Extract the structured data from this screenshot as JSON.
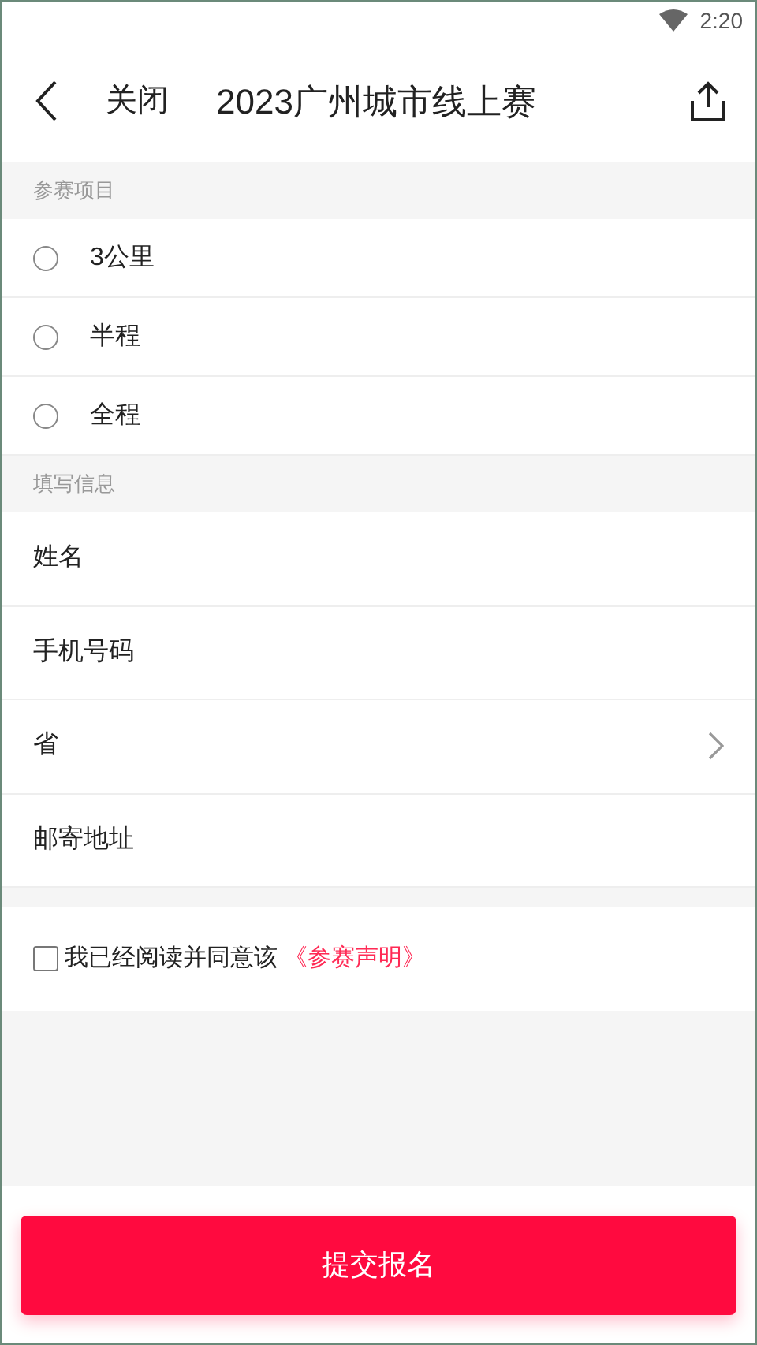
{
  "status_bar": {
    "time": "2:20"
  },
  "header": {
    "close": "关闭",
    "title": "2023广州城市线上赛"
  },
  "event_section": {
    "label": "参赛项目",
    "options": [
      {
        "label": "3公里",
        "selected": false
      },
      {
        "label": "半程",
        "selected": false
      },
      {
        "label": "全程",
        "selected": false
      }
    ]
  },
  "info_section": {
    "label": "填写信息",
    "fields": [
      {
        "label": "姓名",
        "kind": "text"
      },
      {
        "label": "手机号码",
        "kind": "text"
      },
      {
        "label": "省",
        "kind": "select"
      },
      {
        "label": "邮寄地址",
        "kind": "text"
      }
    ]
  },
  "agreement": {
    "checked": false,
    "text": "我已经阅读并同意该",
    "link": "《参赛声明》"
  },
  "submit": "提交报名"
}
